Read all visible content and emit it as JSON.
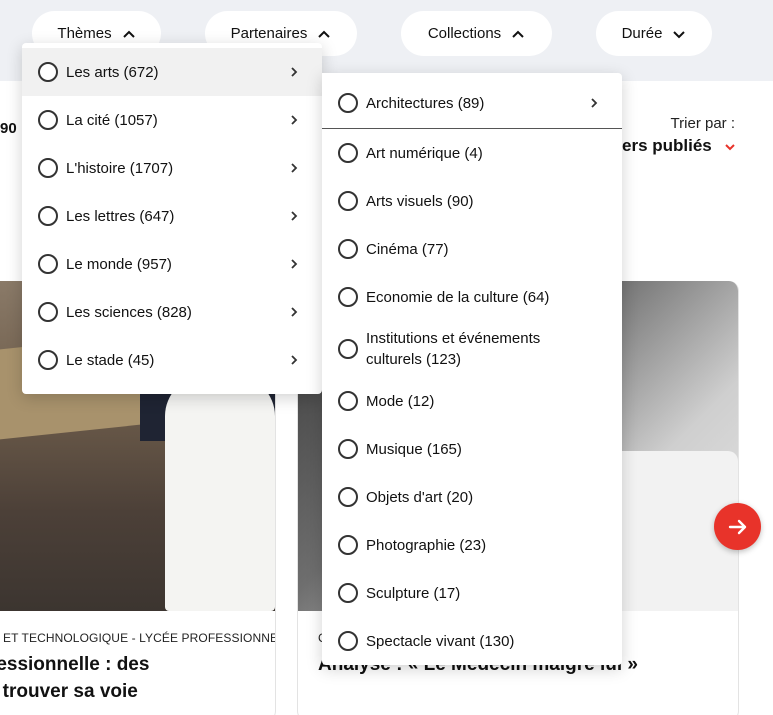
{
  "filters": {
    "themes_label": "Thèmes",
    "partners_label": "Partenaires",
    "collections_label": "Collections",
    "duration_label": "Durée"
  },
  "results": {
    "count_partial": "90"
  },
  "sort": {
    "label": "Trier par :",
    "value": "ers publiés"
  },
  "themes_menu": [
    {
      "label": "Les arts (672)"
    },
    {
      "label": "La cité (1057)"
    },
    {
      "label": "L'histoire (1707)"
    },
    {
      "label": "Les lettres (647)"
    },
    {
      "label": "Le monde (957)"
    },
    {
      "label": "Les sciences (828)"
    },
    {
      "label": "Le stade (45)"
    }
  ],
  "arts_submenu": [
    {
      "label": "Architectures (89)"
    },
    {
      "label": "Art numérique (4)"
    },
    {
      "label": "Arts visuels (90)"
    },
    {
      "label": "Cinéma (77)"
    },
    {
      "label": "Economie de la culture (64)"
    },
    {
      "label": "Institutions et événements culturels (123)"
    },
    {
      "label": "Mode (12)"
    },
    {
      "label": "Musique (165)"
    },
    {
      "label": "Objets d'art (20)"
    },
    {
      "label": "Photographie (23)"
    },
    {
      "label": "Sculpture (17)"
    },
    {
      "label": "Spectacle vivant (130)"
    }
  ],
  "cards": [
    {
      "tag": "ET TECHNOLOGIQUE - LYCÉE PROFESSIONNEL",
      "title_line1": "fessionnelle : des",
      "title_line2": "r trouver sa voie"
    },
    {
      "tag": "C",
      "title_line1": "Analyse : « Le Médecin malgré lui »"
    }
  ],
  "colors": {
    "accent": "#e8332a",
    "filter_bar_bg": "#eef0f4"
  },
  "icons": {
    "chevron_up": "chevron-up-icon",
    "chevron_down": "chevron-down-icon",
    "chevron_right": "chevron-right-icon",
    "arrow_right": "arrow-right-icon"
  }
}
